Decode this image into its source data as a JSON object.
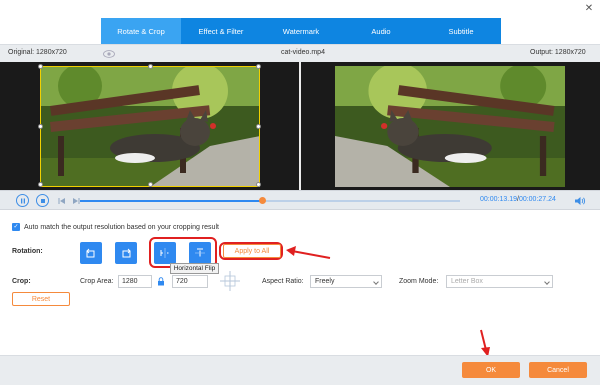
{
  "window": {
    "close_glyph": "✕"
  },
  "tabs": [
    {
      "label": "Rotate & Crop",
      "active": true
    },
    {
      "label": "Effect & Filter",
      "active": false
    },
    {
      "label": "Watermark",
      "active": false
    },
    {
      "label": "Audio",
      "active": false
    },
    {
      "label": "Subtitle",
      "active": false
    }
  ],
  "info": {
    "original": "Original: 1280x720",
    "filename": "cat-video.mp4",
    "output": "Output: 1280x720"
  },
  "player": {
    "time_current": "00:00:13.19",
    "time_separator": "/",
    "time_total": "00:00:27.24",
    "progress": 0.48,
    "icons": [
      "pause-icon",
      "stop-icon",
      "previous-icon",
      "next-icon",
      "volume-icon"
    ]
  },
  "options": {
    "auto_match_label": "Auto match the output resolution based on your cropping result",
    "rotation_label": "Rotation:",
    "apply_all_label": "Apply to All",
    "tooltip": "Horizontal Flip",
    "crop_label": "Crop:",
    "crop_area_label": "Crop Area:",
    "crop_width": "1280",
    "crop_height": "720",
    "aspect_ratio_label": "Aspect Ratio:",
    "aspect_ratio_value": "Freely",
    "zoom_mode_label": "Zoom Mode:",
    "zoom_mode_value": "Letter Box",
    "reset_label": "Reset"
  },
  "footer": {
    "ok_label": "OK",
    "cancel_label": "Cancel"
  },
  "colors": {
    "tab_bar": "#0e85e1",
    "accent_blue": "#2f89f0",
    "accent_orange": "#f58a3c",
    "highlight_red": "#e02020",
    "crop_frame": "#f1d000"
  }
}
